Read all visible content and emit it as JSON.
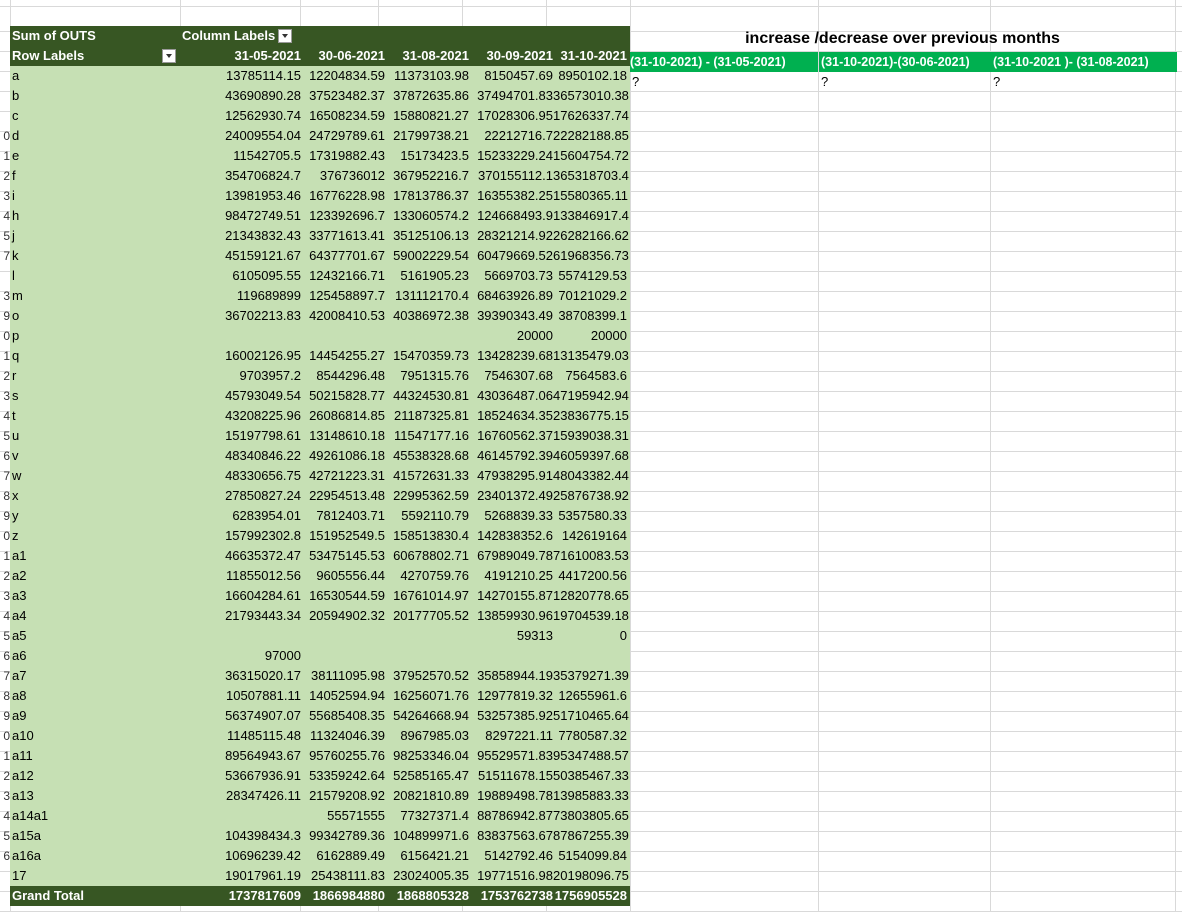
{
  "pivot": {
    "sum_label": "Sum of OUTS",
    "column_labels": "Column Labels",
    "row_labels": "Row Labels",
    "date_headers": [
      "31-05-2021",
      "30-06-2021",
      "31-08-2021",
      "30-09-2021",
      "31-10-2021"
    ],
    "rows": [
      {
        "label": "a",
        "v": [
          "13785114.15",
          "12204834.59",
          "11373103.98",
          "8150457.69",
          "8950102.18"
        ]
      },
      {
        "label": "b",
        "v": [
          "43690890.28",
          "37523482.37",
          "37872635.86",
          "37494701.83",
          "36573010.38"
        ]
      },
      {
        "label": "c",
        "v": [
          "12562930.74",
          "16508234.59",
          "15880821.27",
          "17028306.95",
          "17626337.74"
        ]
      },
      {
        "label": "d",
        "v": [
          "24009554.04",
          "24729789.61",
          "21799738.21",
          "22212716.7",
          "22282188.85"
        ]
      },
      {
        "label": "e",
        "v": [
          "11542705.5",
          "17319882.43",
          "15173423.5",
          "15233229.24",
          "15604754.72"
        ]
      },
      {
        "label": "f",
        "v": [
          "354706824.7",
          "376736012",
          "367952216.7",
          "370155112.1",
          "365318703.4"
        ]
      },
      {
        "label": "i",
        "v": [
          "13981953.46",
          "16776228.98",
          "17813786.37",
          "16355382.25",
          "15580365.11"
        ]
      },
      {
        "label": "h",
        "v": [
          "98472749.51",
          "123392696.7",
          "133060574.2",
          "124668493.9",
          "133846917.4"
        ]
      },
      {
        "label": "j",
        "v": [
          "21343832.43",
          "33771613.41",
          "35125106.13",
          "28321214.92",
          "26282166.62"
        ]
      },
      {
        "label": "k",
        "v": [
          "45159121.67",
          "64377701.67",
          "59002229.54",
          "60479669.52",
          "61968356.73"
        ]
      },
      {
        "label": "l",
        "v": [
          "6105095.55",
          "12432166.71",
          "5161905.23",
          "5669703.73",
          "5574129.53"
        ]
      },
      {
        "label": "m",
        "v": [
          "119689899",
          "125458897.7",
          "131112170.4",
          "68463926.89",
          "70121029.2"
        ]
      },
      {
        "label": "o",
        "v": [
          "36702213.83",
          "42008410.53",
          "40386972.38",
          "39390343.49",
          "38708399.1"
        ]
      },
      {
        "label": "p",
        "v": [
          "",
          "",
          "",
          "20000",
          "20000"
        ]
      },
      {
        "label": "q",
        "v": [
          "16002126.95",
          "14454255.27",
          "15470359.73",
          "13428239.68",
          "13135479.03"
        ]
      },
      {
        "label": "r",
        "v": [
          "9703957.2",
          "8544296.48",
          "7951315.76",
          "7546307.68",
          "7564583.6"
        ]
      },
      {
        "label": "s",
        "v": [
          "45793049.54",
          "50215828.77",
          "44324530.81",
          "43036487.06",
          "47195942.94"
        ]
      },
      {
        "label": "t",
        "v": [
          "43208225.96",
          "26086814.85",
          "21187325.81",
          "18524634.35",
          "23836775.15"
        ]
      },
      {
        "label": "u",
        "v": [
          "15197798.61",
          "13148610.18",
          "11547177.16",
          "16760562.37",
          "15939038.31"
        ]
      },
      {
        "label": "v",
        "v": [
          "48340846.22",
          "49261086.18",
          "45538328.68",
          "46145792.39",
          "46059397.68"
        ]
      },
      {
        "label": "w",
        "v": [
          "48330656.75",
          "42721223.31",
          "41572631.33",
          "47938295.91",
          "48043382.44"
        ]
      },
      {
        "label": "x",
        "v": [
          "27850827.24",
          "22954513.48",
          "22995362.59",
          "23401372.49",
          "25876738.92"
        ]
      },
      {
        "label": "y",
        "v": [
          "6283954.01",
          "7812403.71",
          "5592110.79",
          "5268839.33",
          "5357580.33"
        ]
      },
      {
        "label": "z",
        "v": [
          "157992302.8",
          "151952549.5",
          "158513830.4",
          "142838352.6",
          "142619164"
        ]
      },
      {
        "label": "a1",
        "v": [
          "46635372.47",
          "53475145.53",
          "60678802.71",
          "67989049.78",
          "71610083.53"
        ]
      },
      {
        "label": "a2",
        "v": [
          "11855012.56",
          "9605556.44",
          "4270759.76",
          "4191210.25",
          "4417200.56"
        ]
      },
      {
        "label": "a3",
        "v": [
          "16604284.61",
          "16530544.59",
          "16761014.97",
          "14270155.87",
          "12820778.65"
        ]
      },
      {
        "label": "a4",
        "v": [
          "21793443.34",
          "20594902.32",
          "20177705.52",
          "13859930.96",
          "19704539.18"
        ]
      },
      {
        "label": "a5",
        "v": [
          "",
          "",
          "",
          "59313",
          "0"
        ]
      },
      {
        "label": "a6",
        "v": [
          "97000",
          "",
          "",
          "",
          ""
        ]
      },
      {
        "label": "a7",
        "v": [
          "36315020.17",
          "38111095.98",
          "37952570.52",
          "35858944.19",
          "35379271.39"
        ]
      },
      {
        "label": "a8",
        "v": [
          "10507881.11",
          "14052594.94",
          "16256071.76",
          "12977819.32",
          "12655961.6"
        ]
      },
      {
        "label": "a9",
        "v": [
          "56374907.07",
          "55685408.35",
          "54264668.94",
          "53257385.92",
          "51710465.64"
        ]
      },
      {
        "label": "a10",
        "v": [
          "11485115.48",
          "11324046.39",
          "8967985.03",
          "8297221.11",
          "7780587.32"
        ]
      },
      {
        "label": "a11",
        "v": [
          "89564943.67",
          "95760255.76",
          "98253346.04",
          "95529571.83",
          "95347488.57"
        ]
      },
      {
        "label": "a12",
        "v": [
          "53667936.91",
          "53359242.64",
          "52585165.47",
          "51511678.15",
          "50385467.33"
        ]
      },
      {
        "label": "a13",
        "v": [
          "28347426.11",
          "21579208.92",
          "20821810.89",
          "19889498.78",
          "13985883.33"
        ]
      },
      {
        "label": "a14a1",
        "v": [
          "",
          "55571555",
          "77327371.4",
          "88786942.87",
          "73803805.65"
        ]
      },
      {
        "label": "a15a",
        "v": [
          "104398434.3",
          "99342789.36",
          "104899971.6",
          "83837563.67",
          "87867255.39"
        ]
      },
      {
        "label": "a16a",
        "v": [
          "10696239.42",
          "6162889.49",
          "6156421.21",
          "5142792.46",
          "5154099.84"
        ]
      },
      {
        "label": "17",
        "v": [
          "19017961.19",
          "25438111.83",
          "23024005.35",
          "19771516.98",
          "20198096.75"
        ]
      }
    ],
    "grand_total_label": "Grand Total",
    "grand_total": [
      "1737817609",
      "1866984880",
      "1868805328",
      "1753762738",
      "1756905528"
    ]
  },
  "row_numbers": [
    "",
    "",
    "",
    "",
    "",
    "0",
    "1",
    "2",
    "3",
    "4",
    "5",
    "7",
    "",
    "3",
    "9",
    "0",
    "1",
    "2",
    "3",
    "4",
    "5",
    "6",
    "7",
    "8",
    "9",
    "0",
    "1",
    "2",
    "3",
    "4",
    "5",
    "6",
    "7",
    "8",
    "9",
    "0",
    "1",
    "2",
    "3",
    "4",
    "5",
    "6"
  ],
  "increase": {
    "title": "increase /decrease over previous months",
    "headers": [
      "(31-10-2021) - (31-05-2021)",
      "(31-10-2021)-(30-06-2021)",
      "(31-10-2021 )- (31-08-2021)"
    ],
    "values": [
      "?",
      "?",
      "?"
    ]
  }
}
